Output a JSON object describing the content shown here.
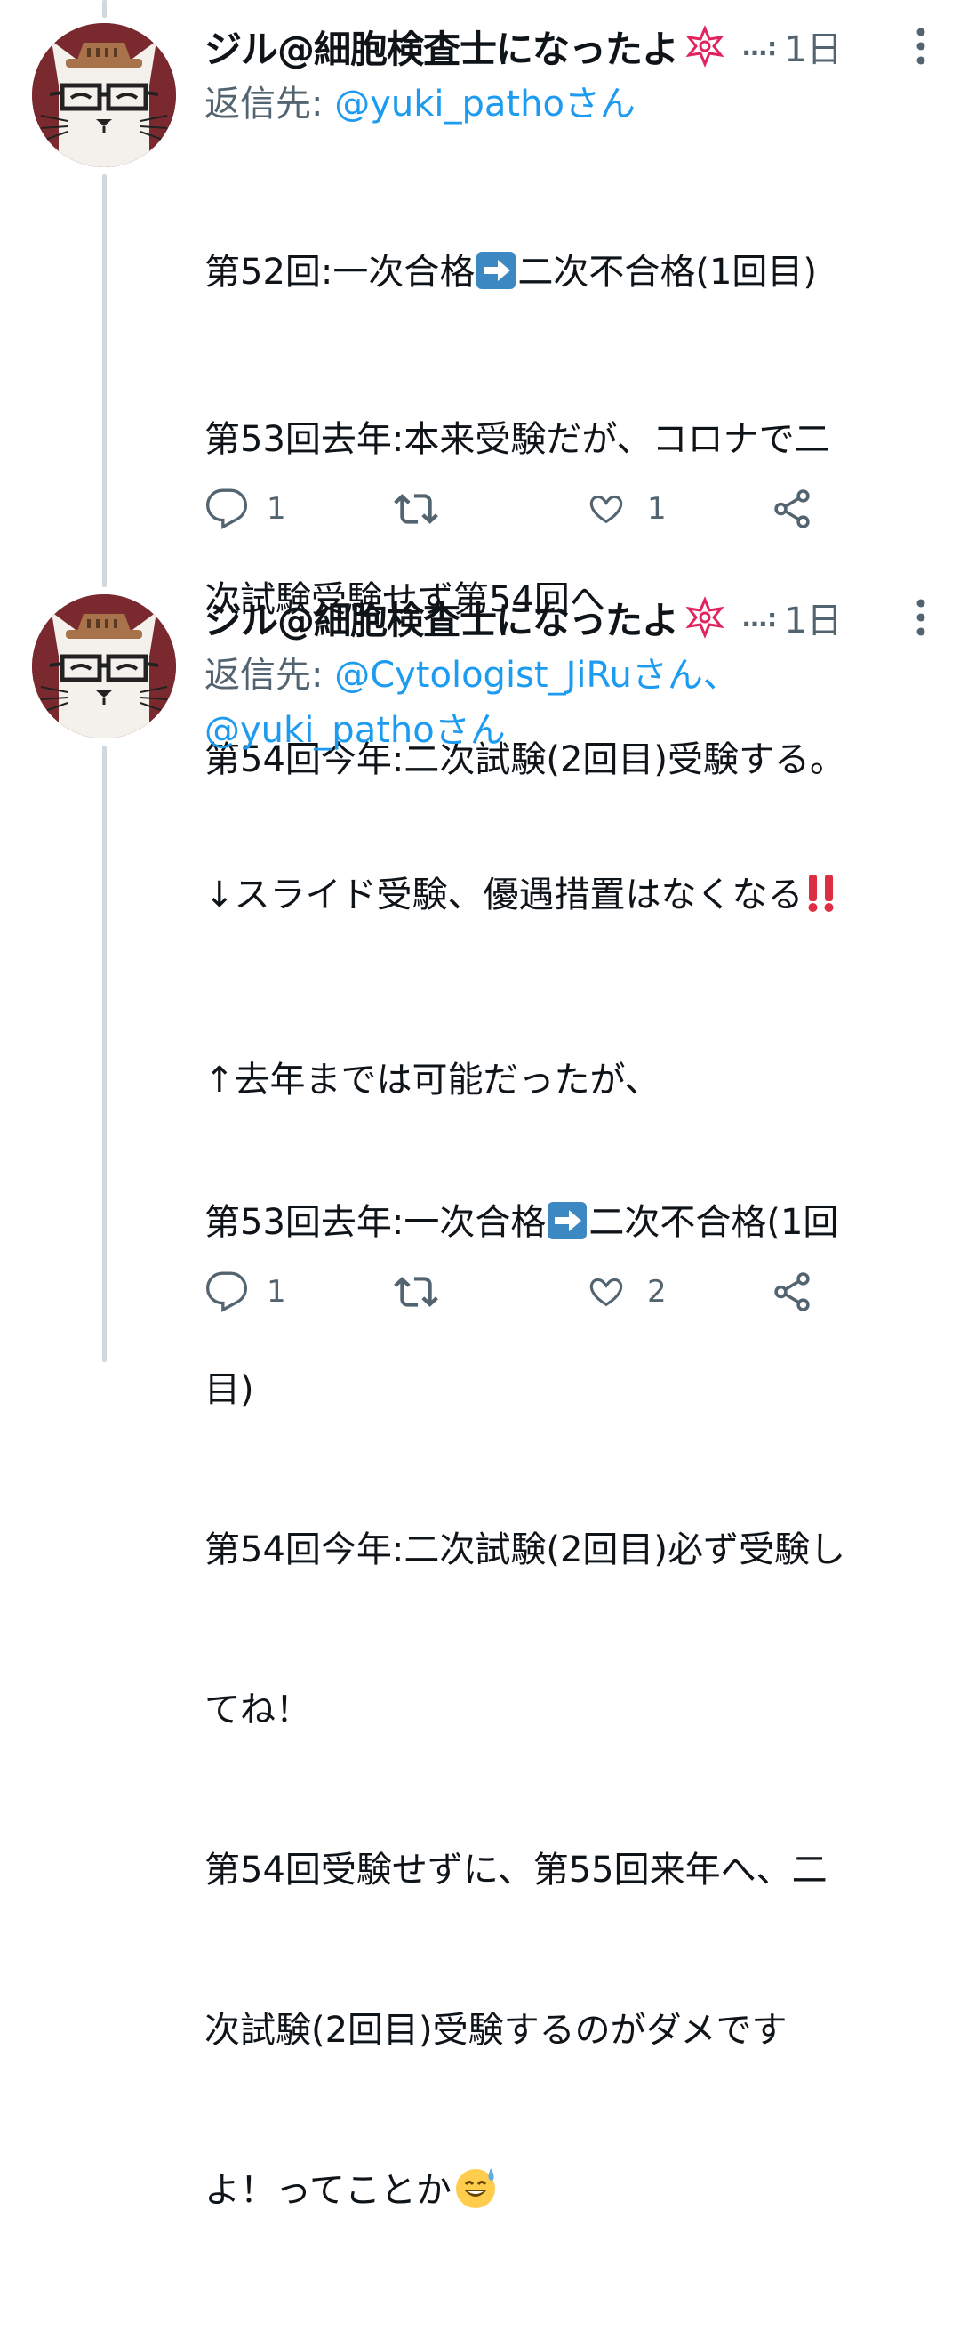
{
  "colors": {
    "text": "#0f1419",
    "secondary": "#536471",
    "link": "#1d9bf0",
    "thread_line": "#cfd9de"
  },
  "tweets": [
    {
      "author_name": "ジル@細胞検査士になったよ",
      "name_badge_icon": "flower-badge-icon",
      "handle_truncated": "…:",
      "time": "1日",
      "reply_prefix": "返信先: ",
      "reply_mentions": [
        "@yuki_pathoさん"
      ],
      "body_lines": [
        {
          "a": "第52回:一次合格",
          "emoji": "right-arrow-emoji",
          "b": "二次不合格(1回目)"
        },
        {
          "a": "第53回去年:本来受験だが、コロナで二"
        },
        {
          "a": "次試験受験せず第54回へ"
        },
        {
          "a": "第54回今年:二次試験(2回目)受験する。"
        },
        {
          "a": ""
        },
        {
          "a": "↑去年までは可能だったが、"
        }
      ],
      "actions": {
        "reply_count": "1",
        "retweet_count": "",
        "like_count": "1"
      }
    },
    {
      "author_name": "ジル@細胞検査士になったよ",
      "name_badge_icon": "flower-badge-icon",
      "handle_truncated": "…:",
      "time": "1日",
      "reply_prefix": "返信先: ",
      "reply_mentions": [
        "@Cytologist_JiRuさん、",
        "@yuki_pathoさん"
      ],
      "body_lines": [
        {
          "a": "↓スライド受験、優遇措置はなくなる",
          "emoji": "double-exclamation-emoji",
          "b": ""
        },
        {
          "a": ""
        },
        {
          "a": "第53回去年:一次合格",
          "emoji": "right-arrow-emoji",
          "b": "二次不合格(1回"
        },
        {
          "a": "目)"
        },
        {
          "a": "第54回今年:二次試験(2回目)必ず受験し"
        },
        {
          "a": "てね！"
        },
        {
          "a": "第54回受験せずに、第55回来年へ、二"
        },
        {
          "a": "次試験(2回目)受験するのがダメです"
        },
        {
          "a": "よ！ってことか",
          "emoji": "sweat-smile-emoji",
          "b": ""
        }
      ],
      "actions": {
        "reply_count": "1",
        "retweet_count": "",
        "like_count": "2"
      }
    }
  ]
}
